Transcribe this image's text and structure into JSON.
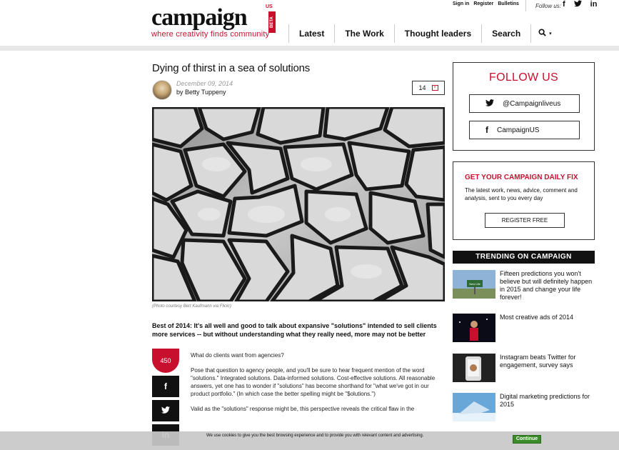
{
  "site": {
    "logo_text": "campaign",
    "logo_region": "US",
    "logo_badge": "BETA",
    "tagline": "where creativity finds community"
  },
  "toplinks": [
    "Sign in",
    "Register",
    "Bulletins"
  ],
  "follow_us_label": "Follow us:",
  "social_icons": [
    "facebook-icon",
    "twitter-icon",
    "linkedin-icon"
  ],
  "nav": {
    "items": [
      "Latest",
      "The Work",
      "Thought leaders",
      "Search"
    ],
    "search_icon": "search-icon",
    "dropdown_icon": "chevron-down-icon"
  },
  "article": {
    "headline": "Dying of thirst in a sea of solutions",
    "date": "December 09, 2014",
    "author": "by Betty Tuppeny",
    "comment_count": "14",
    "caption": "(Photo courtesy Bert Kaufmann via Flickr)",
    "standfirst": "Best of 2014: It's all well and good to talk about expansive \"solutions\" intended to sell clients more services -- but without understanding what they really need, more may not be better",
    "share_count": "450",
    "share_buttons": [
      "facebook-icon",
      "twitter-icon",
      "linkedin-icon"
    ],
    "paragraphs": [
      "What do clients want from agencies?",
      "Pose that question to agency people, and you'll be sure to hear frequent mention of the word \"solutions.\" Integrated solutions. Data-informed solutions. Cost-effective solutions. All reasonable answers, yet one has to wonder if \"solutions\" has become shorthand for \"what we've got in our product portfolio.\" (In which case the better spelling might be \"$olutions.\")",
      "Valid as the \"solutions\" response might be, this perspective reveals the critical flaw in the"
    ]
  },
  "sidebar": {
    "follow_title": "FOLLOW US",
    "twitter_handle": "@Campaignliveus",
    "facebook_handle": "CampaignUS",
    "daily_title": "GET YOUR CAMPAIGN DAILY FIX",
    "daily_text": "The latest work, news, advice, comment and analysis, sent to you every day",
    "register_label": "REGISTER FREE",
    "trending_title": "TRENDING ON CAMPAIGN",
    "trending": [
      "Fifteen predictions you won't believe but will definitely happen in 2015 and change your life forever!",
      "Most creative ads of 2014",
      "Instagram beats Twitter for engagement, survey says",
      "Digital marketing predictions for 2015"
    ]
  },
  "cookie": {
    "text": "We use cookies to give you the best browsing experience and to provide you with relevant content and advertising.",
    "button": "Continue"
  },
  "colors": {
    "accent": "#c8102e",
    "cookie_button": "#3b8b29"
  }
}
